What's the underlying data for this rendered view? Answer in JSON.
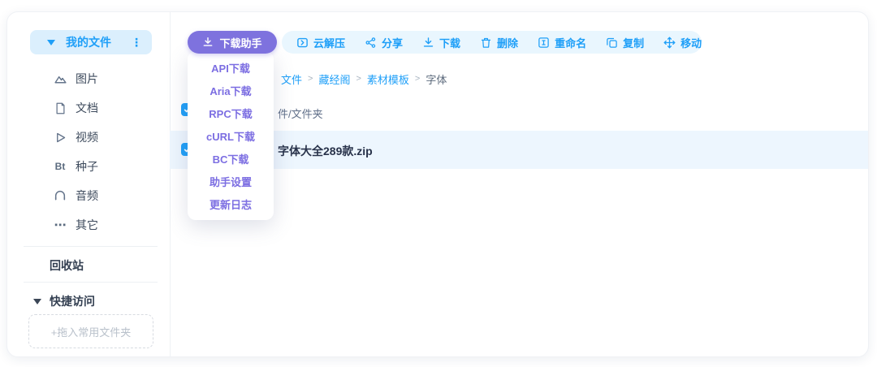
{
  "colors": {
    "accent_blue": "#1e9ff8",
    "accent_purple": "#7e72de",
    "dropdown_text": "#7c6ee2",
    "selected_row_bg": "#edf6fe",
    "sidebar_active_bg": "#dbeffd"
  },
  "sidebar": {
    "my_files": {
      "label": "我的文件",
      "icon": "triangle-down-icon",
      "menu_icon": "kebab-menu-icon"
    },
    "items": [
      {
        "label": "图片",
        "icon": "image-icon"
      },
      {
        "label": "文档",
        "icon": "document-icon"
      },
      {
        "label": "视频",
        "icon": "video-icon"
      },
      {
        "label": "种子",
        "icon": "bt-icon",
        "icon_text": "Bt"
      },
      {
        "label": "音频",
        "icon": "audio-icon"
      },
      {
        "label": "其它",
        "icon": "more-icon",
        "icon_text": "⋯"
      }
    ],
    "recycle_bin": {
      "label": "回收站"
    },
    "quick_access": {
      "label": "快捷访问",
      "icon": "triangle-down-icon"
    },
    "drop_zone": {
      "label": "+拖入常用文件夹"
    }
  },
  "toolbar": {
    "download_assistant": {
      "label": "下载助手",
      "icon": "download-icon"
    },
    "actions": [
      {
        "label": "云解压",
        "icon": "cloud-unzip-icon"
      },
      {
        "label": "分享",
        "icon": "share-icon"
      },
      {
        "label": "下载",
        "icon": "download-icon"
      },
      {
        "label": "删除",
        "icon": "trash-icon"
      },
      {
        "label": "重命名",
        "icon": "rename-icon"
      },
      {
        "label": "复制",
        "icon": "copy-icon"
      },
      {
        "label": "移动",
        "icon": "move-icon"
      }
    ]
  },
  "download_menu": {
    "items": [
      {
        "label": "API下载"
      },
      {
        "label": "Aria下载"
      },
      {
        "label": "RPC下载"
      },
      {
        "label": "cURL下载"
      },
      {
        "label": "BC下载"
      },
      {
        "label": "助手设置"
      },
      {
        "label": "更新日志"
      }
    ]
  },
  "breadcrumb": {
    "separator": ">",
    "items": [
      {
        "label": "文件"
      },
      {
        "label": "藏经阁"
      },
      {
        "label": "素材模板"
      },
      {
        "label": "字体"
      }
    ]
  },
  "file_list": {
    "header": "件/文件夹",
    "rows": [
      {
        "name": "字体大全289款.zip"
      }
    ]
  }
}
